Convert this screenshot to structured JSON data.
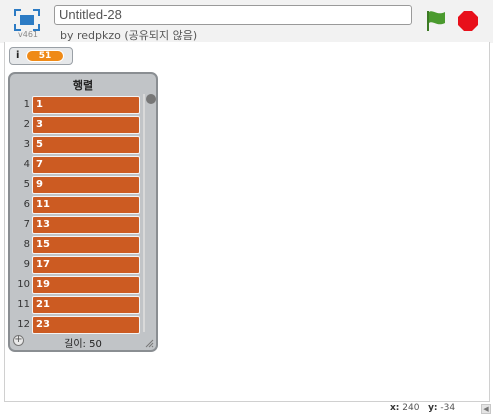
{
  "header": {
    "version": "v461",
    "project_title": "Untitled-28",
    "byline": "by redpkzo (공유되지 않음)",
    "icons": {
      "logo": "fullscreen-stage-icon",
      "flag": "green-flag-icon",
      "stop": "stop-sign-icon"
    },
    "colors": {
      "flag": "#4a9a2e",
      "stop": "#e8101b",
      "logo": "#2c7bc4"
    }
  },
  "variable_monitor": {
    "name": "i",
    "value": "51"
  },
  "list_monitor": {
    "title": "행렬",
    "items": [
      {
        "index": "1",
        "value": "1"
      },
      {
        "index": "2",
        "value": "3"
      },
      {
        "index": "3",
        "value": "5"
      },
      {
        "index": "4",
        "value": "7"
      },
      {
        "index": "5",
        "value": "9"
      },
      {
        "index": "6",
        "value": "11"
      },
      {
        "index": "7",
        "value": "13"
      },
      {
        "index": "8",
        "value": "15"
      },
      {
        "index": "9",
        "value": "17"
      },
      {
        "index": "10",
        "value": "19"
      },
      {
        "index": "11",
        "value": "21"
      },
      {
        "index": "12",
        "value": "23"
      }
    ],
    "add_label": "+",
    "length_label": "길이: 50",
    "colors": {
      "item": "#cc5b22",
      "frame": "#c1c4c7"
    }
  },
  "footer": {
    "x_label": "x:",
    "x_value": "240",
    "y_label": "y:",
    "y_value": "-34",
    "scroll_arrow": "◀"
  }
}
